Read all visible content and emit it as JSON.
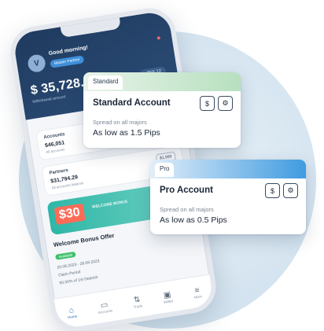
{
  "phone": {
    "greeting": "Good morning!",
    "partner_badge": "Master Partner",
    "avatar_initial": "V",
    "balance": "$ 35,728.62",
    "balance_sub": "Withdrawal amount",
    "balance_chip": "+$58.12",
    "accounts_title": "Accounts",
    "accounts_value": "$46,051",
    "accounts_sub": "All accounts",
    "partners_title": "Partners",
    "partners_value": "$31,794.29",
    "partners_sub": "All accounts balance",
    "partners_chip": "$1,999",
    "promo_amount": "$30",
    "promo_side": "WELCOME BONUS",
    "bonus_title": "Welcome Bonus Offer",
    "bonus_badge": "Available",
    "bonus_date": "20.08.2023 - 28.08.2023",
    "bonus_date_sub": "Claim Period",
    "bonus_detail": "50.00% of 1st Deposit",
    "tabs": [
      "Home",
      "Accounts",
      "Trade",
      "Wallet",
      "More"
    ]
  },
  "cards": [
    {
      "tab_label": "Standard",
      "title": "Standard Account",
      "spread_label": "Spread on all majors",
      "spread_value": "As low as 1.5 Pips",
      "dollar_icon": "$",
      "settings_icon": "gear-icon"
    },
    {
      "tab_label": "Pro",
      "title": "Pro Account",
      "spread_label": "Spread on all majors",
      "spread_value": "As low as 0.5 Pips",
      "dollar_icon": "$",
      "settings_icon": "gear-icon"
    }
  ],
  "colors": {
    "standard_accent": "#b7e0bf",
    "pro_accent": "#3f9be0",
    "phone_header": "#1f3a5e"
  }
}
